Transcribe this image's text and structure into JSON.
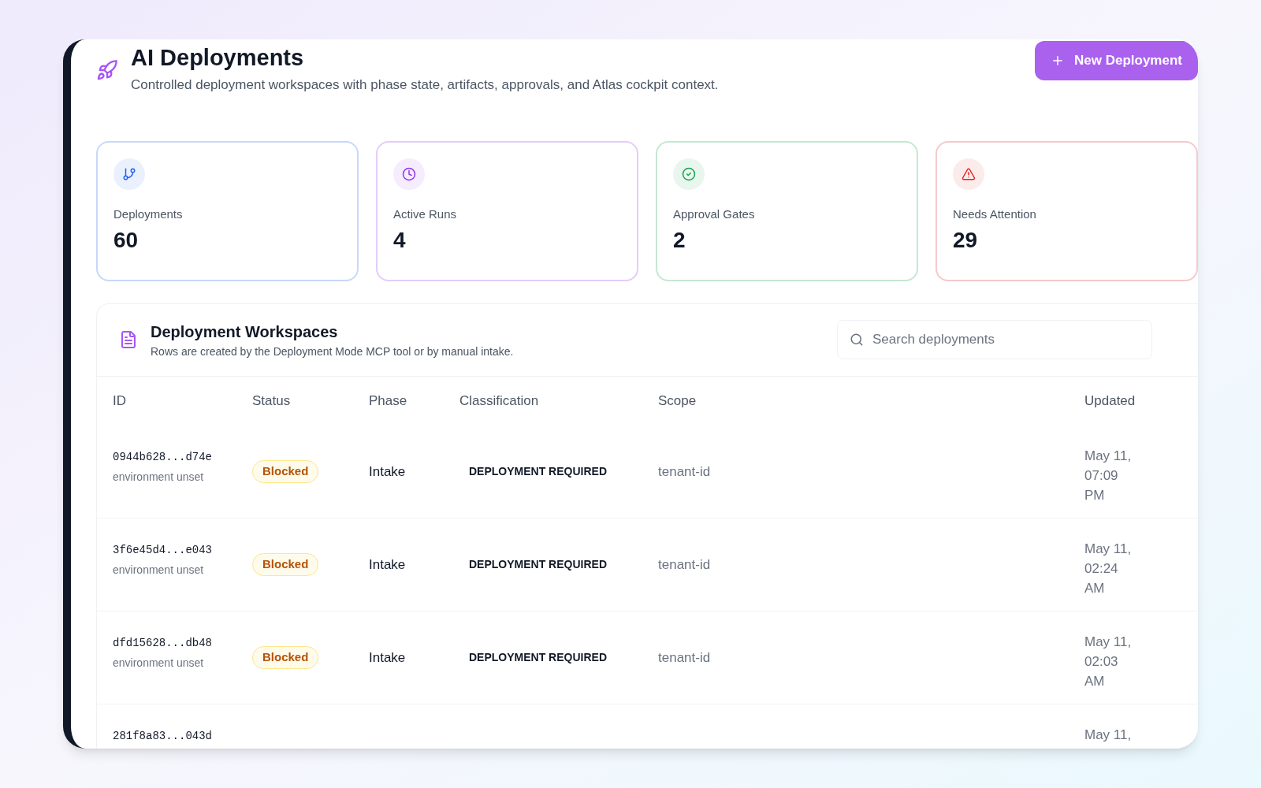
{
  "header": {
    "title": "AI Deployments",
    "subtitle": "Controlled deployment workspaces with phase state, artifacts, approvals, and Atlas cockpit context.",
    "new_button": "New Deployment"
  },
  "stats": [
    {
      "kind": "branch",
      "label": "Deployments",
      "value": "60",
      "color": "#2563eb"
    },
    {
      "kind": "clock",
      "label": "Active Runs",
      "value": "4",
      "color": "#9333ea"
    },
    {
      "kind": "check",
      "label": "Approval Gates",
      "value": "2",
      "color": "#16a34a"
    },
    {
      "kind": "alert",
      "label": "Needs Attention",
      "value": "29",
      "color": "#dc2626"
    }
  ],
  "workspaces": {
    "title": "Deployment Workspaces",
    "subtitle": "Rows are created by the Deployment Mode MCP tool or by manual intake.",
    "search": {
      "placeholder": "Search deployments"
    },
    "columns": [
      "ID",
      "Status",
      "Phase",
      "Classification",
      "Scope",
      "Updated"
    ],
    "rows": [
      {
        "id": "0944b628...d74e",
        "environment": "environment unset",
        "status": "Blocked",
        "phase": "Intake",
        "classification": "DEPLOYMENT REQUIRED",
        "scope": "tenant-id",
        "updated": [
          "May 11,",
          "07:09",
          "PM"
        ]
      },
      {
        "id": "3f6e45d4...e043",
        "environment": "environment unset",
        "status": "Blocked",
        "phase": "Intake",
        "classification": "DEPLOYMENT REQUIRED",
        "scope": "tenant-id",
        "updated": [
          "May 11,",
          "02:24",
          "AM"
        ]
      },
      {
        "id": "dfd15628...db48",
        "environment": "environment unset",
        "status": "Blocked",
        "phase": "Intake",
        "classification": "DEPLOYMENT REQUIRED",
        "scope": "tenant-id",
        "updated": [
          "May 11,",
          "02:03",
          "AM"
        ]
      },
      {
        "id": "281f8a83...043d",
        "updated": [
          "May 11,"
        ]
      }
    ]
  }
}
